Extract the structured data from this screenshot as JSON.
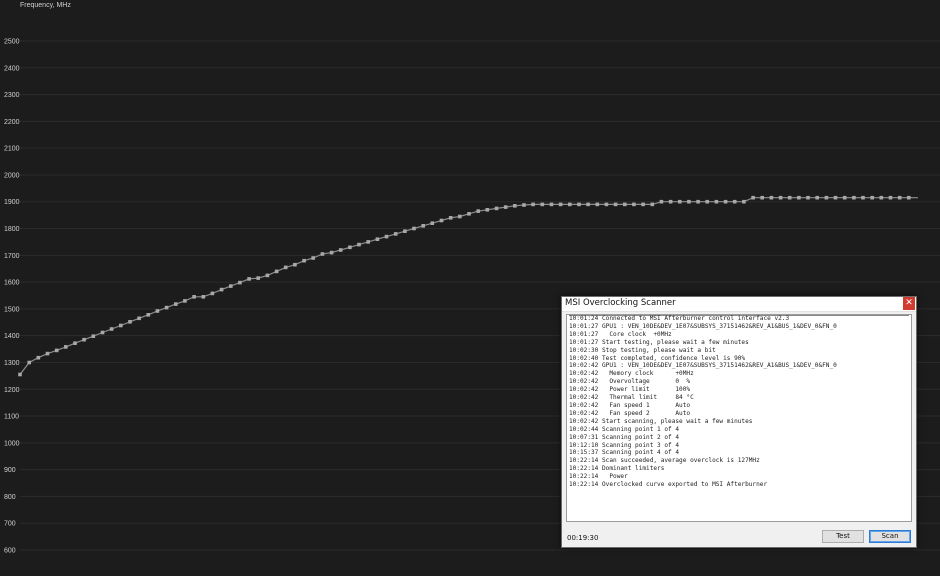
{
  "curve_editor": {
    "y_axis_label": "Frequency, MHz",
    "y_ticks": [
      2500,
      2400,
      2300,
      2200,
      2100,
      2000,
      1900,
      1800,
      1700,
      1600,
      1500,
      1400,
      1300,
      1200,
      1100,
      1000,
      900,
      800,
      700,
      600
    ],
    "colors": {
      "background": "#1c1c1c",
      "grid": "#2b2b2b",
      "curve": "#8d8d8d",
      "point": "#a8a8a8",
      "tick_text": "#d0d0d0"
    }
  },
  "chart_data": {
    "type": "line",
    "ylabel": "Frequency, MHz",
    "ylim": [
      600,
      2500
    ],
    "grid": true,
    "series": [
      {
        "values": [
          1255,
          1300,
          1318,
          1333,
          1345,
          1358,
          1372,
          1385,
          1398,
          1412,
          1425,
          1438,
          1452,
          1465,
          1478,
          1492,
          1505,
          1518,
          1530,
          1545,
          1545,
          1558,
          1572,
          1585,
          1598,
          1612,
          1615,
          1625,
          1640,
          1655,
          1665,
          1680,
          1690,
          1705,
          1710,
          1720,
          1730,
          1740,
          1750,
          1760,
          1770,
          1780,
          1790,
          1800,
          1810,
          1820,
          1830,
          1840,
          1845,
          1855,
          1865,
          1870,
          1875,
          1880,
          1885,
          1888,
          1890,
          1890,
          1890,
          1890,
          1890,
          1890,
          1890,
          1890,
          1890,
          1890,
          1890,
          1890,
          1890,
          1890,
          1900,
          1900,
          1900,
          1900,
          1900,
          1900,
          1900,
          1900,
          1900,
          1900,
          1915,
          1915,
          1915,
          1915,
          1915,
          1915,
          1915,
          1915,
          1915,
          1915,
          1915,
          1915,
          1915,
          1915,
          1915,
          1915,
          1915,
          1915,
          1915
        ]
      }
    ]
  },
  "scanner": {
    "title": "MSI Overclocking Scanner",
    "close_label": "✕",
    "log_lines": [
      "10:01:24 Connected to MSI Afterburner control interface v2.3",
      "10:01:27 GPU1 : VEN_10DE&DEV_1E07&SUBSYS_37151462&REV_A1&BUS_1&DEV_0&FN_0",
      "10:01:27   Core clock  +0MHz",
      "10:01:27 Start testing, please wait a few minutes",
      "10:02:30 Stop testing, please wait a bit",
      "10:02:40 Test completed, confidence level is 90%",
      "10:02:42 GPU1 : VEN_10DE&DEV_1E07&SUBSYS_37151462&REV_A1&BUS_1&DEV_0&FN_0",
      "10:02:42   Memory clock      +0MHz",
      "10:02:42   Overvoltage       0  %",
      "10:02:42   Power limit       100%",
      "10:02:42   Thermal limit     84 °C",
      "10:02:42   Fan speed 1       Auto",
      "10:02:42   Fan speed 2       Auto",
      "10:02:42 Start scanning, please wait a few minutes",
      "10:02:44 Scanning point 1 of 4",
      "10:07:31 Scanning point 2 of 4",
      "10:12:10 Scanning point 3 of 4",
      "10:15:37 Scanning point 4 of 4",
      "10:22:14 Scan succeeded, average overclock is 127MHz",
      "10:22:14 Dominant limiters",
      "10:22:14   Power",
      "10:22:14 Overclocked curve exported to MSI Afterburner"
    ],
    "elapsed": "00:19:30",
    "test_label": "Test",
    "scan_label": "Scan"
  }
}
